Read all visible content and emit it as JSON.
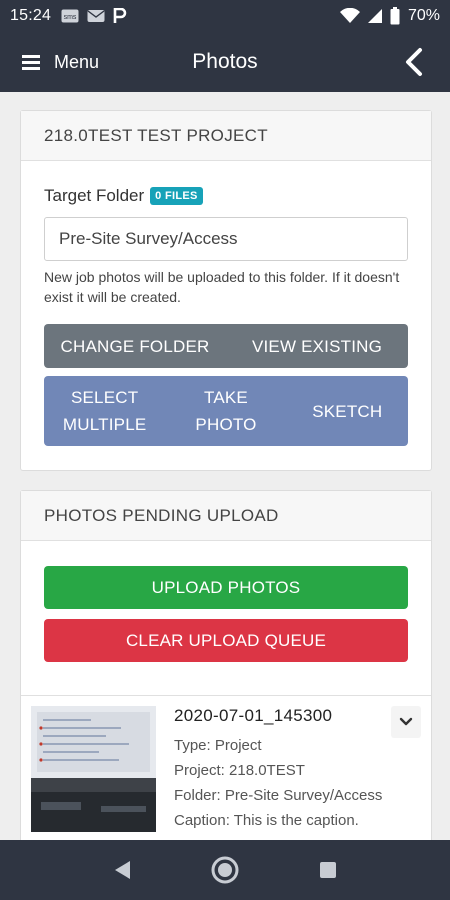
{
  "status_bar": {
    "time": "15:24",
    "battery": "70%",
    "notification_icons": [
      "sms-icon",
      "mail-icon",
      "parking-icon"
    ]
  },
  "app_bar": {
    "menu_label": "Menu",
    "title": "Photos"
  },
  "project_card": {
    "title": "218.0TEST TEST PROJECT",
    "target_folder_label": "Target Folder",
    "files_badge": "0 FILES",
    "folder_value": "Pre-Site Survey/Access",
    "help_text": "New job photos will be uploaded to this folder. If it doesn't exist it will be created.",
    "change_folder": "CHANGE FOLDER",
    "view_existing": "VIEW EXISTING",
    "select_multiple_line1": "SELECT",
    "select_multiple_line2": "MULTIPLE",
    "take_photo_line1": "TAKE",
    "take_photo_line2": "PHOTO",
    "sketch": "SKETCH"
  },
  "pending_card": {
    "title": "PHOTOS PENDING UPLOAD",
    "upload_label": "UPLOAD PHOTOS",
    "clear_label": "CLEAR UPLOAD QUEUE",
    "items": [
      {
        "name": "2020-07-01_145300",
        "type": "Type: Project",
        "project": "Project: 218.0TEST",
        "folder": "Folder: Pre-Site Survey/Access",
        "caption": "Caption: This is the caption."
      }
    ]
  },
  "colors": {
    "header": "#2f3542",
    "gray_button": "#6c757d",
    "blue_button": "#7187b7",
    "upload": "#28a745",
    "clear": "#dc3545",
    "badge": "#17a2b8"
  }
}
